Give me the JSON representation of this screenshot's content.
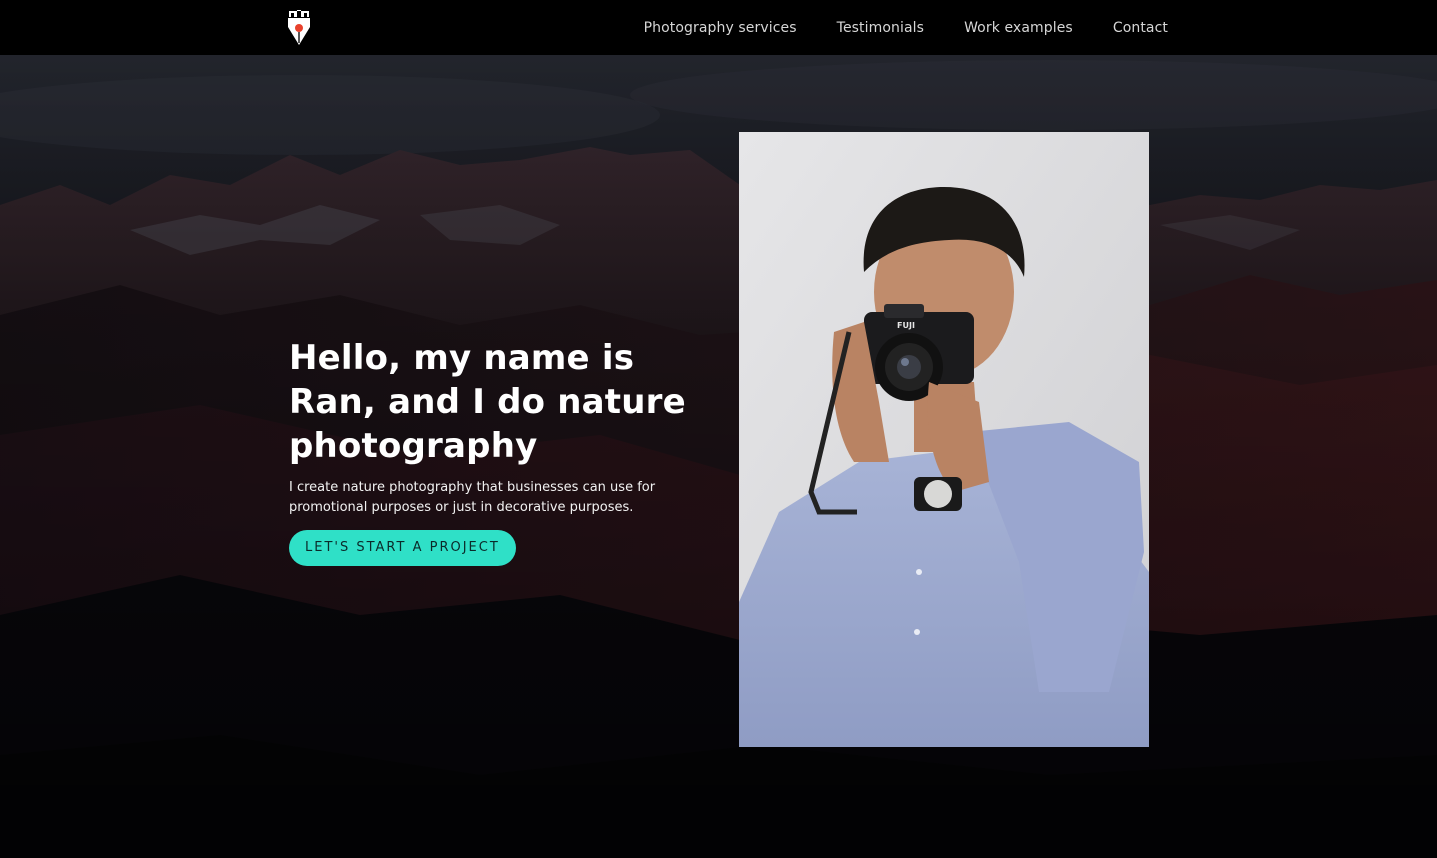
{
  "nav": {
    "logo_icon": "fountain-pen-tower-logo",
    "links": [
      {
        "label": "Photography services"
      },
      {
        "label": "Testimonials"
      },
      {
        "label": "Work examples"
      },
      {
        "label": "Contact"
      }
    ]
  },
  "hero": {
    "title": "Hello, my name is Ran, and I do nature photography",
    "subtitle": "I create nature photography that businesses can use for promotional purposes or just in decorative purposes.",
    "cta_label": "LET'S START A PROJECT",
    "background_image": "dark-mountain-landscape",
    "portrait_image": "man-holding-fuji-camera",
    "camera_brand": "FUJI"
  },
  "colors": {
    "accent": "#2fe0c7",
    "nav_bg": "#000000",
    "logo_dot": "#e8412c"
  }
}
